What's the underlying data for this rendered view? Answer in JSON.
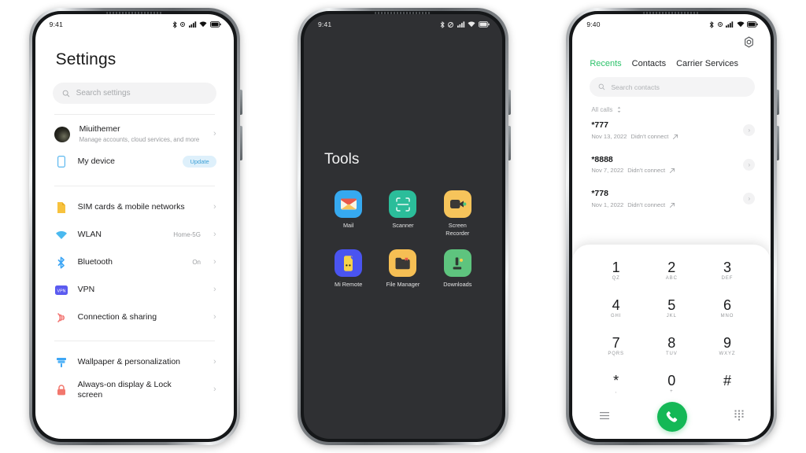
{
  "phones": [
    {
      "id": "settings-phone",
      "status_bar": {
        "time": "9:41",
        "icons": [
          "bluetooth-icon",
          "alarm-icon",
          "signal-icon",
          "wifi-icon",
          "battery-icon"
        ]
      },
      "screen": "settings"
    },
    {
      "id": "tools-folder-phone",
      "status_bar": {
        "time": "9:41",
        "icons": [
          "bluetooth-icon",
          "mute-icon",
          "signal-icon",
          "wifi-icon",
          "battery-icon"
        ]
      },
      "screen": "tools"
    },
    {
      "id": "dialer-phone",
      "status_bar": {
        "time": "9:40",
        "icons": [
          "bluetooth-icon",
          "alarm-icon",
          "signal-icon",
          "wifi-icon",
          "battery-icon"
        ]
      },
      "screen": "dialer"
    }
  ],
  "settings": {
    "title": "Settings",
    "search": {
      "placeholder": "Search settings",
      "icon": "search-icon"
    },
    "account": {
      "name": "Miuithemer",
      "subtitle": "Manage accounts, cloud services, and more",
      "avatar": "user-avatar"
    },
    "device": {
      "label": "My device",
      "badge": "Update",
      "icon": "phone-outline-icon"
    },
    "groups": [
      {
        "items": [
          {
            "label": "SIM cards & mobile networks",
            "value": "",
            "icon": "sim-card-icon",
            "color": "#f7c23e"
          },
          {
            "label": "WLAN",
            "value": "Home-5G",
            "icon": "wifi-icon",
            "color": "#4ab9ef"
          },
          {
            "label": "Bluetooth",
            "value": "On",
            "icon": "bluetooth-icon",
            "color": "#3ea6f5"
          },
          {
            "label": "VPN",
            "value": "",
            "icon": "vpn-icon",
            "color": "#5b5bf0"
          },
          {
            "label": "Connection & sharing",
            "value": "",
            "icon": "connection-sharing-icon",
            "color": "#f2706d"
          }
        ]
      },
      {
        "items": [
          {
            "label": "Wallpaper & personalization",
            "value": "",
            "icon": "wallpaper-brush-icon",
            "color": "#3ea6f5"
          },
          {
            "label": "Always-on display & Lock screen",
            "value": "",
            "icon": "lock-icon",
            "color": "#f2776d"
          }
        ]
      }
    ],
    "chevron": "chevron-right-icon"
  },
  "tools": {
    "title": "Tools",
    "apps": [
      {
        "name": "Mail",
        "icon": "mail-icon",
        "bg": "#36a9f0"
      },
      {
        "name": "Scanner",
        "icon": "scanner-icon",
        "bg": "#2bbd9a"
      },
      {
        "name": "Screen Recorder",
        "icon": "screen-recorder-icon",
        "bg": "#f6c45b"
      },
      {
        "name": "Mi Remote",
        "icon": "mi-remote-icon",
        "bg": "#4a54f0"
      },
      {
        "name": "File Manager",
        "icon": "file-manager-icon",
        "bg": "#f6bf54"
      },
      {
        "name": "Downloads",
        "icon": "downloads-icon",
        "bg": "#5ec47e"
      }
    ]
  },
  "dialer": {
    "settings_icon": "gear-icon",
    "tabs": [
      {
        "label": "Recents",
        "active": true
      },
      {
        "label": "Contacts",
        "active": false
      },
      {
        "label": "Carrier Services",
        "active": false
      }
    ],
    "accent_color": "#2cc26a",
    "search": {
      "placeholder": "Search contacts",
      "icon": "search-icon"
    },
    "filter": {
      "label": "All calls",
      "icon": "sort-icon"
    },
    "calls": [
      {
        "number": "*777",
        "date": "Nov 13, 2022",
        "status": "Didn't connect",
        "direction_icon": "outgoing-call-icon"
      },
      {
        "number": "*8888",
        "date": "Nov 7, 2022",
        "status": "Didn't connect",
        "direction_icon": "outgoing-call-icon"
      },
      {
        "number": "*778",
        "date": "Nov 1, 2022",
        "status": "Didn't connect",
        "direction_icon": "outgoing-call-icon"
      }
    ],
    "keypad": [
      {
        "digit": "1",
        "letters": "QZ"
      },
      {
        "digit": "2",
        "letters": "ABC"
      },
      {
        "digit": "3",
        "letters": "DEF"
      },
      {
        "digit": "4",
        "letters": "GHI"
      },
      {
        "digit": "5",
        "letters": "JKL"
      },
      {
        "digit": "6",
        "letters": "MNO"
      },
      {
        "digit": "7",
        "letters": "PQRS"
      },
      {
        "digit": "8",
        "letters": "TUV"
      },
      {
        "digit": "9",
        "letters": "WXYZ"
      },
      {
        "digit": "*",
        "letters": ","
      },
      {
        "digit": "0",
        "letters": "+"
      },
      {
        "digit": "#",
        "letters": ""
      }
    ],
    "bottom_bar": {
      "left_icon": "menu-lines-icon",
      "call_icon": "phone-call-icon",
      "right_icon": "keypad-dots-icon"
    }
  }
}
